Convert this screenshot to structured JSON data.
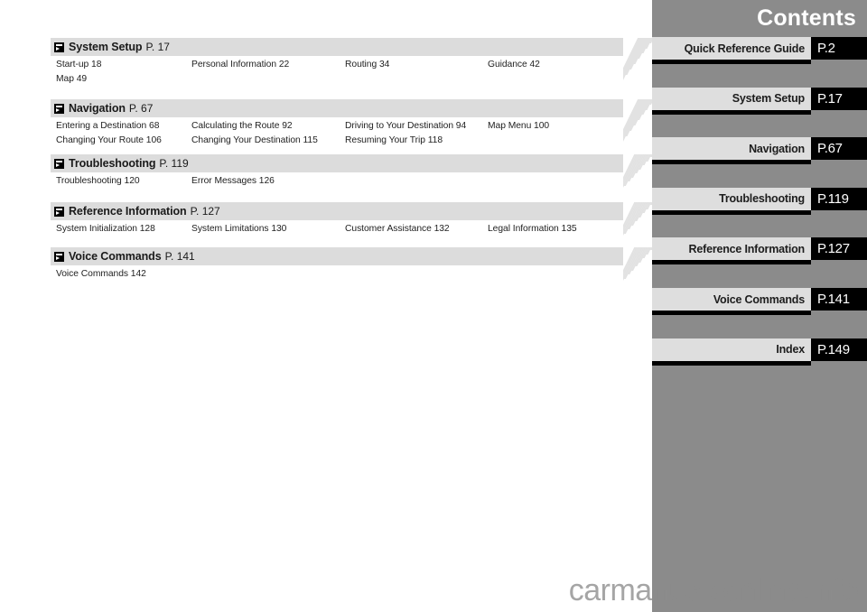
{
  "sidebar": {
    "heading": "Contents",
    "tabs": [
      {
        "label": "Quick Reference Guide",
        "page": "P.2"
      },
      {
        "label": "System Setup",
        "page": "P.17"
      },
      {
        "label": "Navigation",
        "page": "P.67"
      },
      {
        "label": "Troubleshooting",
        "page": "P.119"
      },
      {
        "label": "Reference Information",
        "page": "P.127"
      },
      {
        "label": "Voice Commands",
        "page": "P.141"
      },
      {
        "label": "Index",
        "page": "P.149"
      }
    ],
    "colors": {
      "background": "#8b8b8b",
      "label_block": "#dedede",
      "page_block": "#000000",
      "heading_text": "#ffffff"
    }
  },
  "sections": [
    {
      "icon": "arrow-jump-icon",
      "title": "System Setup",
      "page": "P. 17",
      "rows": [
        [
          "Start-up 18",
          "Personal Information 22",
          "Routing 34",
          "Guidance 42"
        ],
        [
          "Map 49",
          "",
          "",
          ""
        ]
      ]
    },
    {
      "icon": "arrow-jump-icon",
      "title": "Navigation",
      "page": "P. 67",
      "rows": [
        [
          "Entering a Destination 68",
          "Calculating the Route 92",
          "Driving to Your Destination 94",
          "Map Menu 100"
        ],
        [
          "Changing Your Route 106",
          "Changing Your Destination 115",
          "Resuming Your Trip 118",
          ""
        ]
      ]
    },
    {
      "icon": "arrow-jump-icon",
      "title": "Troubleshooting",
      "page": "P. 119",
      "rows": [
        [
          "Troubleshooting 120",
          "Error Messages 126",
          "",
          ""
        ]
      ]
    },
    {
      "icon": "arrow-jump-icon",
      "title": "Reference Information",
      "page": "P. 127",
      "rows": [
        [
          "System Initialization 128",
          "System Limitations 130",
          "Customer Assistance 132",
          "Legal Information 135"
        ]
      ]
    },
    {
      "icon": "arrow-jump-icon",
      "title": "Voice Commands",
      "page": "P. 141",
      "rows": [
        [
          "Voice Commands 142",
          "",
          "",
          ""
        ]
      ]
    }
  ],
  "watermark": {
    "text": "carmanualsonline.info"
  }
}
